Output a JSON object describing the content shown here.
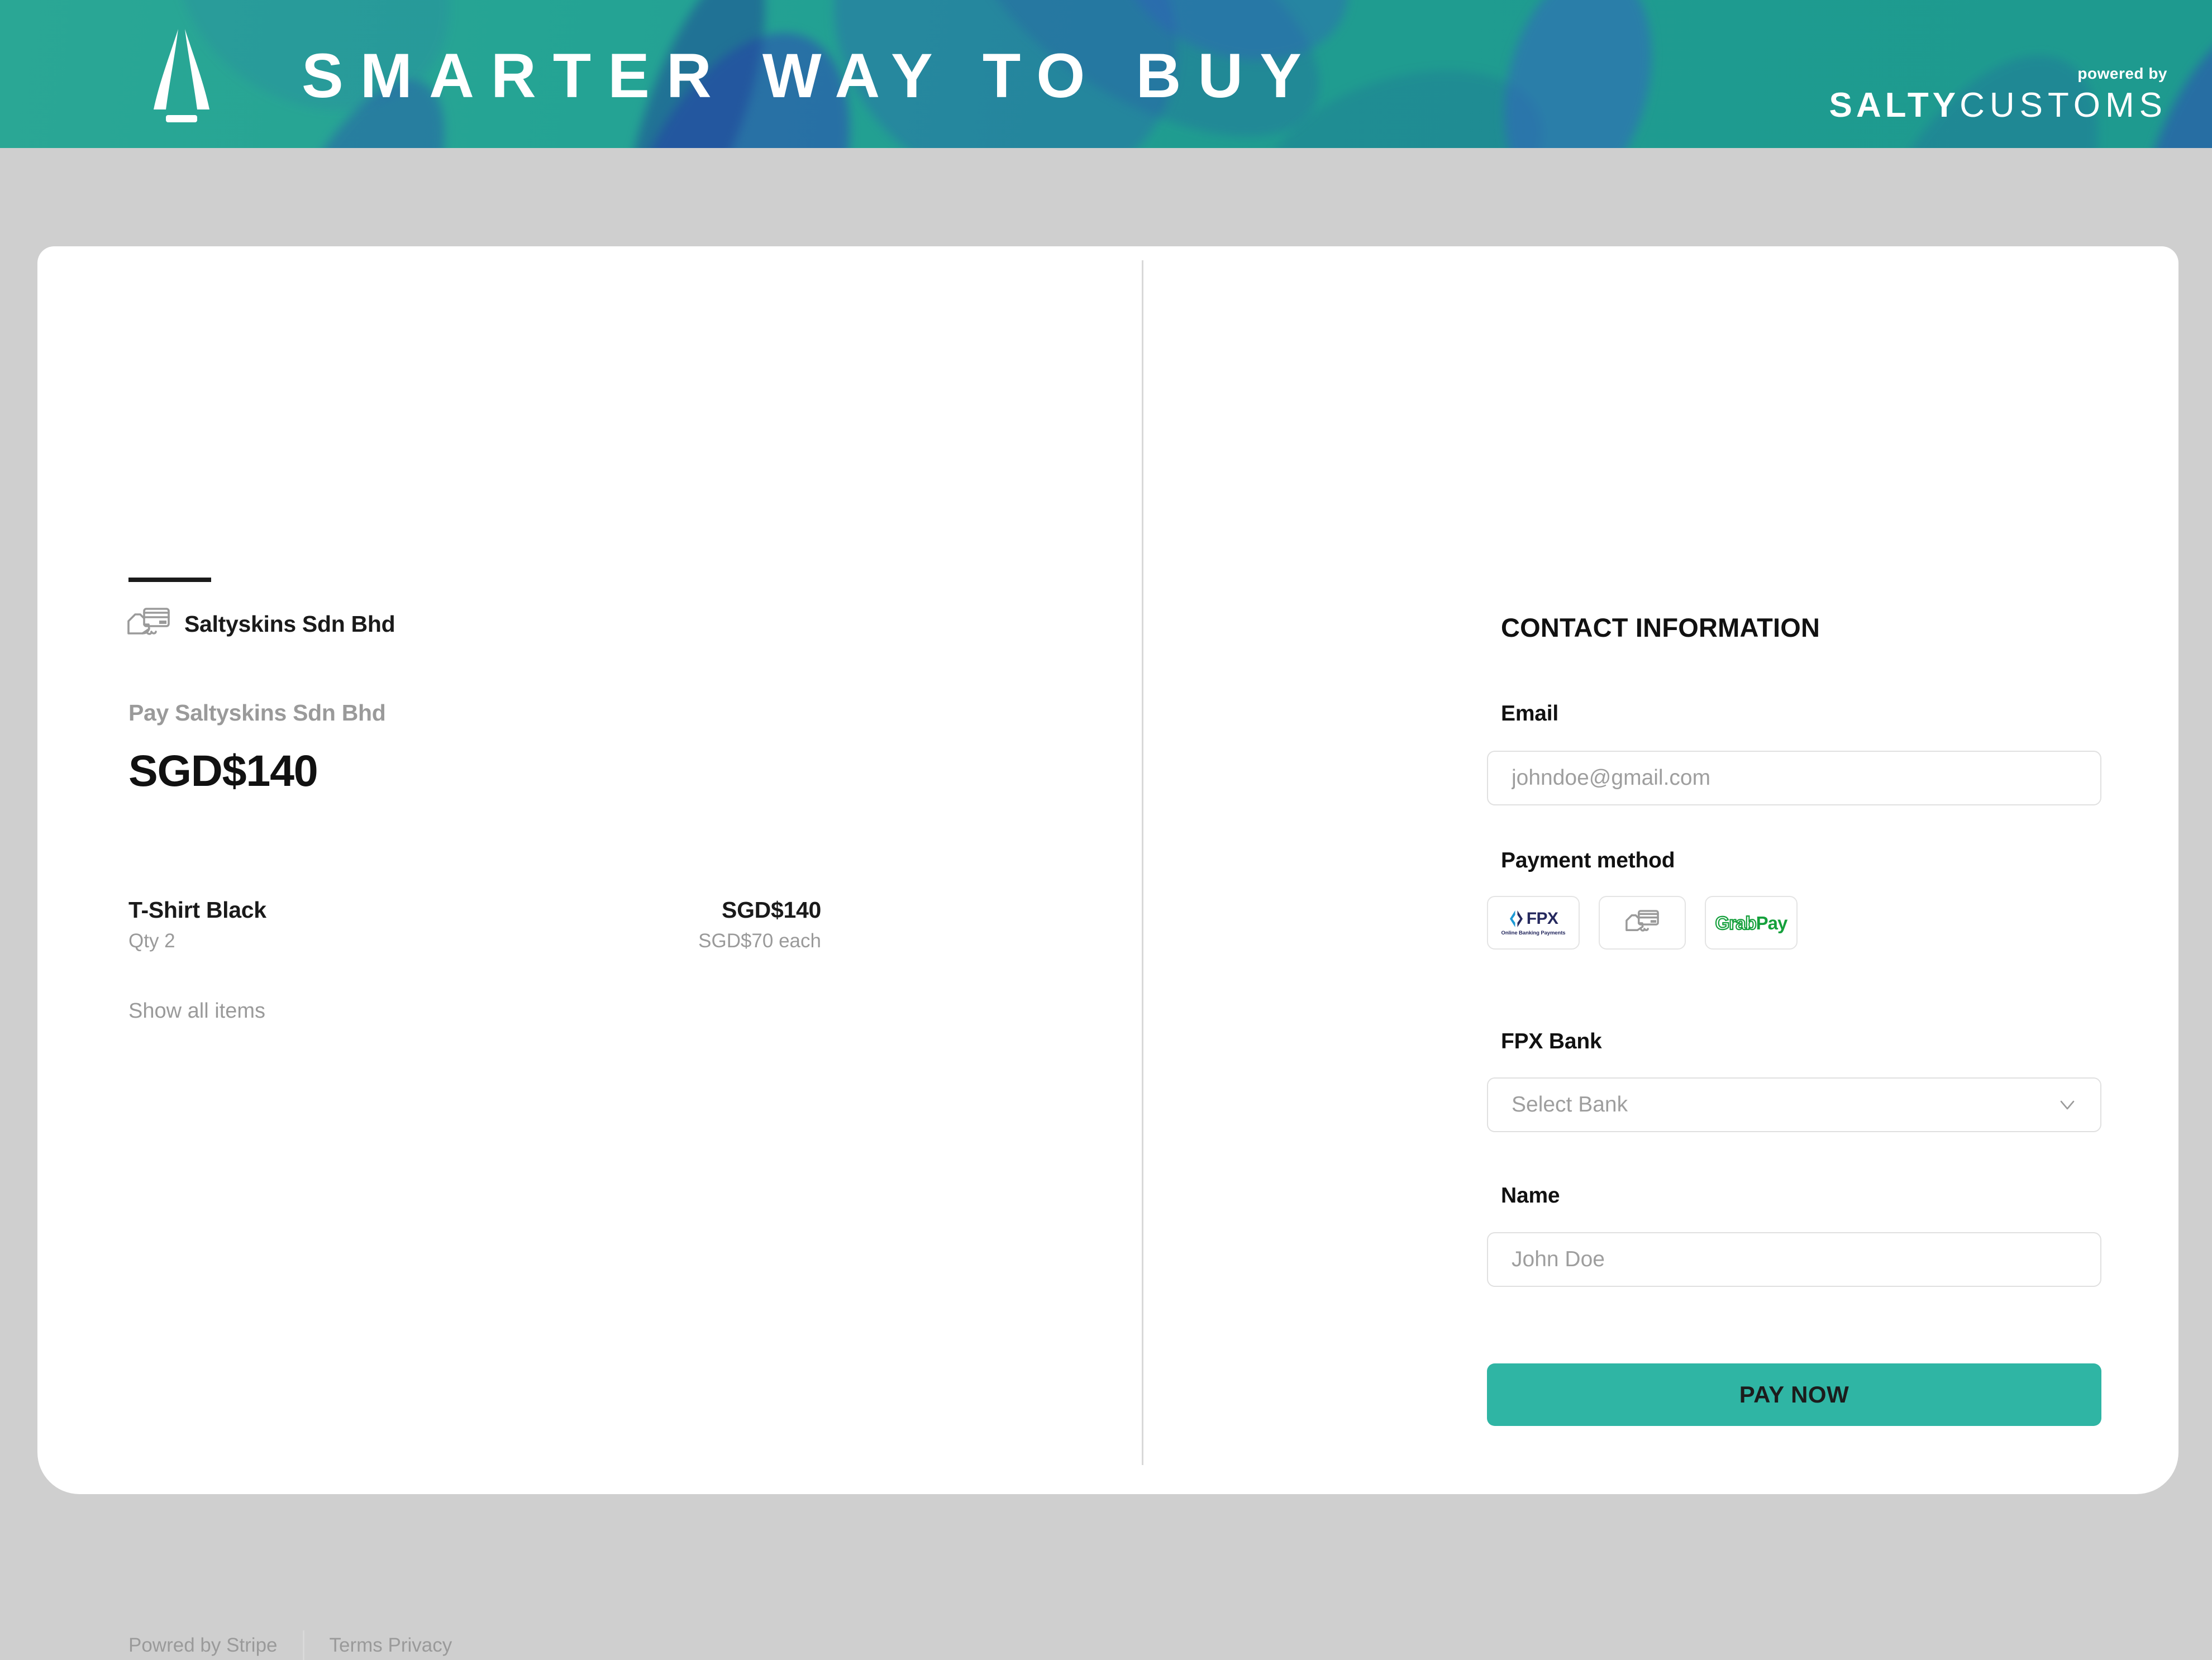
{
  "banner": {
    "title": "SMARTER WAY TO BUY",
    "logo_icon": "saltycustoms-peak-logo-icon",
    "powered_by": "powered by",
    "brand_bold": "SALTY",
    "brand_light": "CUSTOMS",
    "bg_color": "#24a394",
    "text_color": "#ffffff"
  },
  "summary": {
    "merchant_icon": "card-in-hand-icon",
    "merchant_name": "Saltyskins Sdn Bhd",
    "pay_label": "Pay Saltyskins Sdn Bhd",
    "amount": "SGD$140",
    "item": {
      "name": "T-Shirt Black",
      "qty": "Qty 2",
      "total": "SGD$140",
      "each": "SGD$70 each"
    },
    "show_all_items": "Show all items"
  },
  "footer": {
    "powered_by_stripe": "Powred by Stripe",
    "terms_privacy": "Terms Privacy"
  },
  "form": {
    "section_title": "CONTACT INFORMATION",
    "email_label": "Email",
    "email_value": "",
    "email_placeholder": "johndoe@gmail.com",
    "payment_method_label": "Payment method",
    "payment_methods": [
      {
        "id": "fpx",
        "name": "FPX",
        "sub": "Online Banking Payments",
        "icon": "fpx-logo-icon",
        "selected": false
      },
      {
        "id": "card",
        "name": "Card",
        "icon": "card-in-hand-icon",
        "selected": false
      },
      {
        "id": "grabpay",
        "name_a": "Grab",
        "name_b": "Pay",
        "icon": "grabpay-logo-icon",
        "selected": false
      }
    ],
    "fpx_bank_label": "FPX Bank",
    "fpx_bank_value": "Select Bank",
    "fpx_bank_chevron": "chevron-down-icon",
    "name_label": "Name",
    "name_value": "",
    "name_placeholder": "John Doe",
    "pay_now_label": "PAY NOW",
    "accent_color": "#2fb5a4"
  }
}
